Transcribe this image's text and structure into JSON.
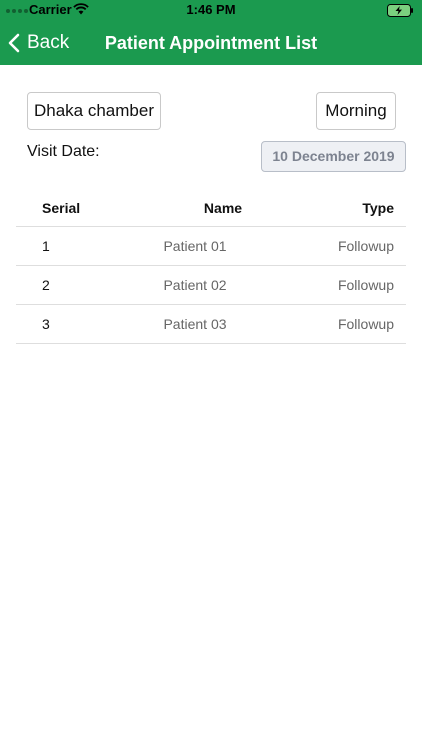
{
  "status_bar": {
    "carrier": "Carrier",
    "time": "1:46 PM"
  },
  "nav": {
    "back_label": "Back",
    "title": "Patient Appointment List"
  },
  "filters": {
    "chamber": "Dhaka chamber",
    "session": "Morning",
    "visit_date_label": "Visit Date:",
    "visit_date": "10 December 2019"
  },
  "table": {
    "headers": {
      "serial": "Serial",
      "name": "Name",
      "type": "Type"
    },
    "rows": [
      {
        "serial": "1",
        "name": "Patient 01",
        "type": "Followup"
      },
      {
        "serial": "2",
        "name": "Patient 02",
        "type": "Followup"
      },
      {
        "serial": "3",
        "name": "Patient 03",
        "type": "Followup"
      }
    ]
  },
  "colors": {
    "brand_green": "#1b9a4f",
    "date_text": "#7d8390"
  },
  "icons": [
    "signal-icon",
    "wifi-icon",
    "battery-charging-icon",
    "chevron-left-icon"
  ]
}
